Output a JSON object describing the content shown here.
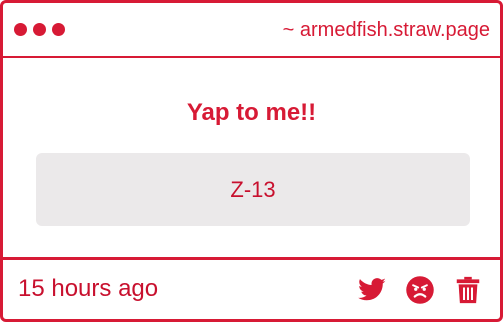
{
  "window": {
    "url": "~ armedfish.straw.page"
  },
  "question": {
    "prompt": "Yap to me!!"
  },
  "response": {
    "text": "Z-13"
  },
  "footer": {
    "time": "15 hours ago"
  },
  "icons": {
    "dots": [
      "window-dot-icon",
      "window-dot-icon",
      "window-dot-icon"
    ],
    "share": "twitter-bird-icon",
    "report": "angry-face-icon",
    "delete": "trash-icon"
  },
  "colors": {
    "accent": "#d71a35",
    "response_bg": "#ebe9ea"
  }
}
